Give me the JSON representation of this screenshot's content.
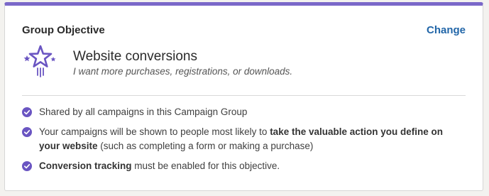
{
  "card": {
    "title": "Group Objective",
    "change_label": "Change",
    "accent_color": "#7a68c9"
  },
  "objective": {
    "icon": "shooting-star-icon",
    "name": "Website conversions",
    "description": "I want more purchases, registrations, or downloads."
  },
  "bullets": [
    {
      "icon": "check-circle-icon",
      "segments": [
        {
          "text": "Shared by all campaigns in this Campaign Group",
          "bold": false
        }
      ]
    },
    {
      "icon": "check-circle-icon",
      "segments": [
        {
          "text": "Your campaigns will be shown to people most likely to ",
          "bold": false
        },
        {
          "text": "take the valuable action you define on your website",
          "bold": true
        },
        {
          "text": " (such as completing a form or making a purchase)",
          "bold": false
        }
      ]
    },
    {
      "icon": "check-circle-icon",
      "segments": [
        {
          "text": "Conversion tracking",
          "bold": true
        },
        {
          "text": " must be enabled for this objective.",
          "bold": false
        }
      ]
    }
  ]
}
